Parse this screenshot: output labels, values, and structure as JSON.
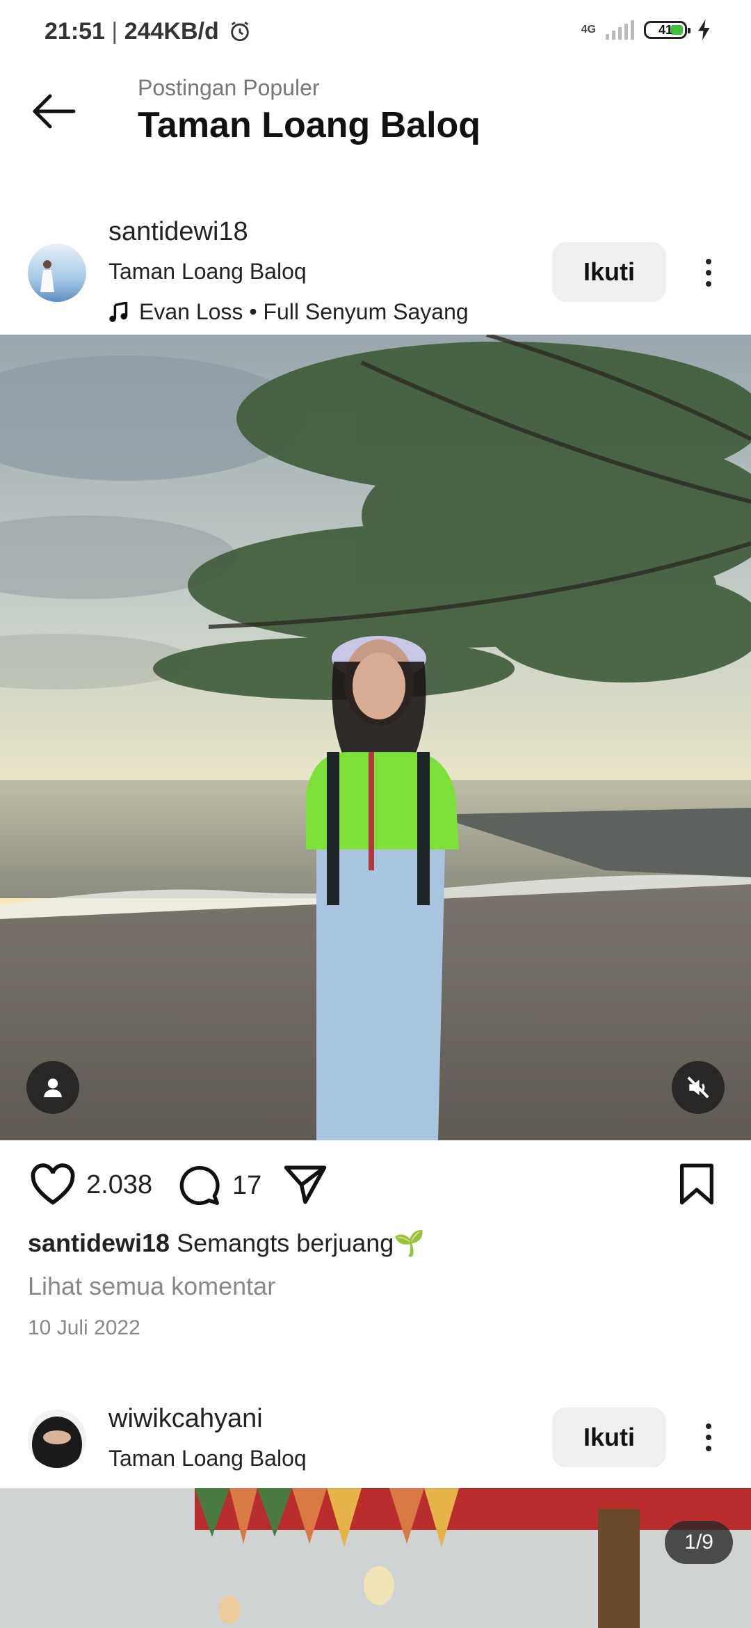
{
  "status_bar": {
    "time": "21:51",
    "speed": "244KB/d",
    "network": "4G",
    "battery": "41"
  },
  "header": {
    "subtitle": "Postingan Populer",
    "title": "Taman Loang Baloq"
  },
  "posts": [
    {
      "username": "santidewi18",
      "location": "Taman Loang Baloq",
      "music": "Evan Loss • Full Senyum Sayang",
      "follow_label": "Ikuti",
      "likes": "2.038",
      "comments": "17",
      "caption_user": "santidewi18",
      "caption_text": "Semangts berjuang🌱",
      "view_comments": "Lihat semua komentar",
      "date": "10 Juli 2022"
    },
    {
      "username": "wiwikcahyani",
      "location": "Taman Loang Baloq",
      "follow_label": "Ikuti",
      "pager": "1/9"
    }
  ],
  "colors": {
    "accent_green": "#3ec13e",
    "follow_bg": "#efefef",
    "muted_text": "#888888"
  },
  "icons": [
    "back-arrow-icon",
    "alarm-icon",
    "music-note-icon",
    "more-vertical-icon",
    "user-tag-icon",
    "mute-icon",
    "heart-icon",
    "comment-icon",
    "share-icon",
    "bookmark-icon"
  ]
}
